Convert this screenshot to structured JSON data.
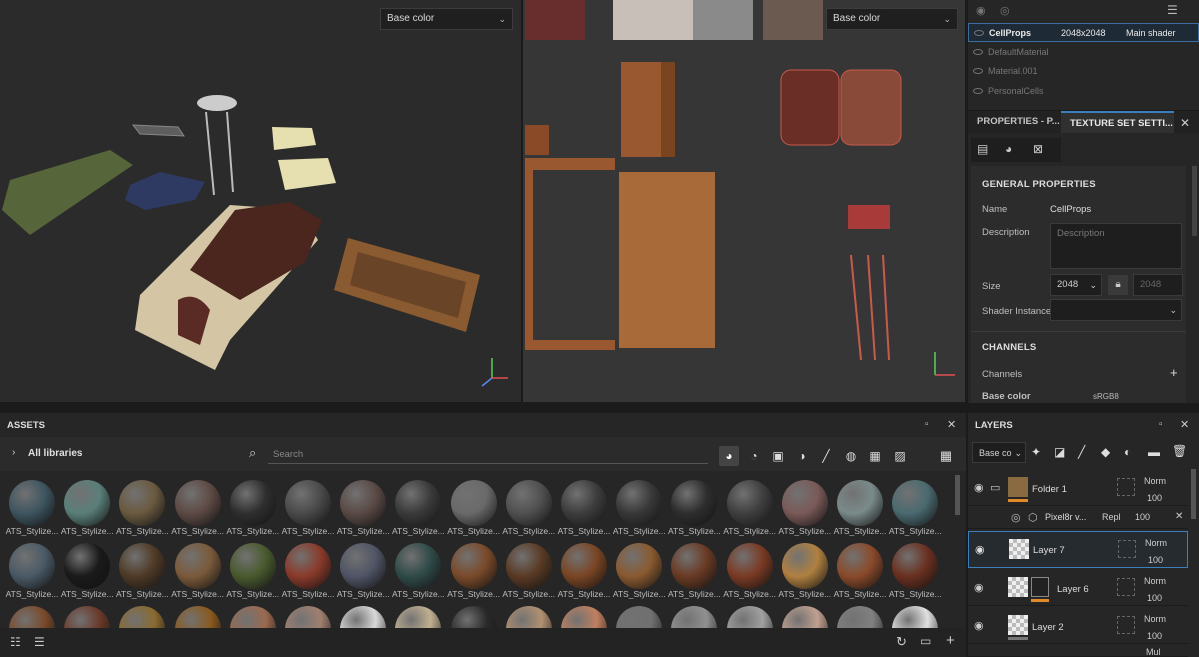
{
  "viewport3d": {
    "channel_select": "Base color"
  },
  "viewport2d": {
    "channel_select": "Base color"
  },
  "texture_sets": {
    "items": [
      {
        "name": "CellProps",
        "size": "2048x2048",
        "shader": "Main shader"
      },
      {
        "name": "DefaultMaterial"
      },
      {
        "name": "Material.001"
      },
      {
        "name": "PersonalCells"
      }
    ]
  },
  "properties": {
    "tab_properties": "PROPERTIES - P...",
    "tab_texture_set": "TEXTURE SET SETTI...",
    "general_title": "GENERAL PROPERTIES",
    "name_label": "Name",
    "name_value": "CellProps",
    "description_label": "Description",
    "description_placeholder": "Description",
    "size_label": "Size",
    "size_value": "2048",
    "size_linked_value": "2048",
    "shader_label": "Shader Instance",
    "channels_title": "CHANNELS",
    "channels_label": "Channels",
    "base_color_label": "Base color",
    "base_color_format": "sRGB8"
  },
  "assets": {
    "title": "ASSETS",
    "libraries": "All libraries",
    "search_placeholder": "Search",
    "row1_label": "ATS_Stylize...",
    "row2_label": "ATS_Stylize...",
    "row1_colors": [
      "#3e5560",
      "#5a7f7a",
      "#6a5a40",
      "#5e4a44",
      "#2f2f2f",
      "#4a4a4a",
      "#5a4a46",
      "#3a3a3a",
      "#6a6a6a",
      "#505050",
      "#3d3d3d",
      "#383838",
      "#2e2e2e",
      "#3f3f3f",
      "#7a5a58",
      "#7a8a8a",
      "#4a6a70"
    ],
    "row2_colors": [
      "#4a5a66",
      "#1a1a1a",
      "#4f3a26",
      "#7a5a3a",
      "#4a5a2e",
      "#8a3a2a",
      "#505566",
      "#2f4a48",
      "#7a4a2a",
      "#5a3a24",
      "#7a4524",
      "#8a5a30",
      "#6a3a24",
      "#7a3a24",
      "#b08040",
      "#8a4a2a",
      "#6a3020"
    ],
    "row3_colors": [
      "#7a4a2a",
      "#6a3a2a",
      "#8a6a30",
      "#8a5a20",
      "#9a6a50",
      "#a08070",
      "#d8d8d8",
      "#c0b090",
      "#2a2a2a",
      "#b09070",
      "#c08060",
      "#707070",
      "#909090",
      "#a0a0a0",
      "#c0a090",
      "#808080",
      "#e0e0e0"
    ]
  },
  "layers": {
    "title": "LAYERS",
    "channel_select": "Base co",
    "items": [
      {
        "name": "Folder 1",
        "blend": "Norm",
        "opacity": "100"
      },
      {
        "name": "Pixel8r v...",
        "blend": "Repl",
        "opacity": "100"
      },
      {
        "name": "Layer 7",
        "blend": "Norm",
        "opacity": "100"
      },
      {
        "name": "Layer 6",
        "blend": "Norm",
        "opacity": "100"
      },
      {
        "name": "Layer 2",
        "blend": "Norm",
        "opacity": "100"
      }
    ],
    "bottom_blend": "Mul"
  },
  "colors": {
    "accent": "#3d7ebf",
    "orange": "#e08a2a"
  }
}
